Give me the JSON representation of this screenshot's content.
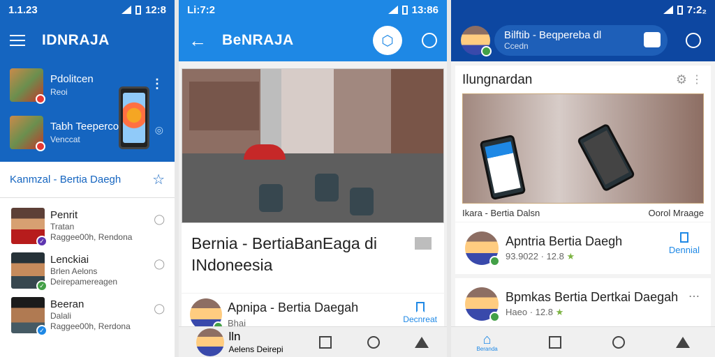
{
  "panel1": {
    "time": "1.1.23",
    "status_right": "12:8",
    "app_title": "IDNRAJA",
    "drawer_items": [
      {
        "title": "Pdolitcen",
        "sub": "Reoi"
      },
      {
        "title": "Tabh Teeperco",
        "sub": "Venccat"
      }
    ],
    "section_label": "Kanmzal - Bertia Daegh",
    "list": [
      {
        "name": "Penrit",
        "sub1": "Tratan",
        "sub2": "Raggee00h, Rendona",
        "badge_color": "#5e35b1"
      },
      {
        "name": "Lenckiai",
        "sub1": "Brlen Aelons Deirepamereagen",
        "sub2": "",
        "badge_color": "#43a047"
      },
      {
        "name": "Beeran",
        "sub1": "Dalali",
        "sub2": "Raggee00h, Rerdona",
        "badge_color": "#1e88e5"
      }
    ]
  },
  "panel2": {
    "status_left": "Li:7:2",
    "status_right": "13:86",
    "app_title": "BeNRAJA",
    "article_title": "Bernia - BertiaBanEaga di INdoneesia",
    "row": {
      "name": "Apnipa - Bertia Daegah",
      "sub": "Bhai",
      "action": "Decnreat"
    },
    "nav_item": {
      "name": "lln",
      "sub": "Aelens Deirepi"
    }
  },
  "panel3": {
    "status_right": "7:2₂",
    "search_title": "Bilftib - Beqpereba dl",
    "search_sub": "Ccedn",
    "card_heading": "Ilungnardan",
    "card_foot_left": "Ikara - Bertia Dalsn",
    "card_foot_right": "Oorol Mraage",
    "rows": [
      {
        "name": "Apntria Bertia Daegh",
        "sub": "93.9022",
        "rating": "12.8",
        "action": "Dennial"
      },
      {
        "name": "Bpmkas Bertia Dertkai Daegah",
        "sub": "Haeo",
        "rating": "12.8",
        "action": ""
      }
    ],
    "nav_home_label": "Beranda"
  },
  "colors": {
    "primary": "#1565c0",
    "accent": "#1e88e5",
    "dark": "#0d47a1"
  }
}
